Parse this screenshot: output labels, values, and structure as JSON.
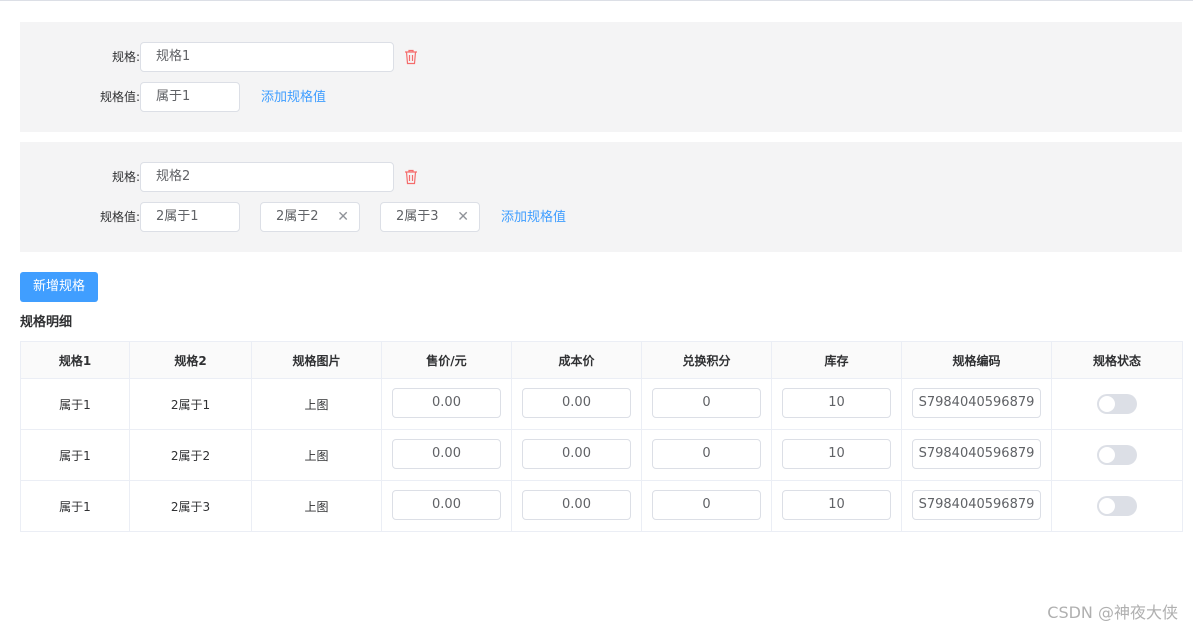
{
  "specs": [
    {
      "spec_label": "规格:",
      "spec_value": "规格1",
      "values_label": "规格值:",
      "values": [
        "属于1"
      ],
      "add_value_label": "添加规格值"
    },
    {
      "spec_label": "规格:",
      "spec_value": "规格2",
      "values_label": "规格值:",
      "values": [
        "2属于1",
        "2属于2",
        "2属于3"
      ],
      "add_value_label": "添加规格值"
    }
  ],
  "add_spec_button": "新增规格",
  "detail_title": "规格明细",
  "table": {
    "headers": [
      "规格1",
      "规格2",
      "规格图片",
      "售价/元",
      "成本价",
      "兑换积分",
      "库存",
      "规格编码",
      "规格状态"
    ],
    "rows": [
      {
        "spec1": "属于1",
        "spec2": "2属于1",
        "image": "上图",
        "price": "0.00",
        "cost": "0.00",
        "points": "0",
        "stock": "10",
        "code": "S7984040596879",
        "status": false
      },
      {
        "spec1": "属于1",
        "spec2": "2属于2",
        "image": "上图",
        "price": "0.00",
        "cost": "0.00",
        "points": "0",
        "stock": "10",
        "code": "S7984040596879",
        "status": false
      },
      {
        "spec1": "属于1",
        "spec2": "2属于3",
        "image": "上图",
        "price": "0.00",
        "cost": "0.00",
        "points": "0",
        "stock": "10",
        "code": "S7984040596879",
        "status": false
      }
    ]
  },
  "watermark": "CSDN @神夜大侠",
  "colors": {
    "primary": "#409eff",
    "danger": "#f56c6c",
    "panel_bg": "#f4f4f5"
  }
}
